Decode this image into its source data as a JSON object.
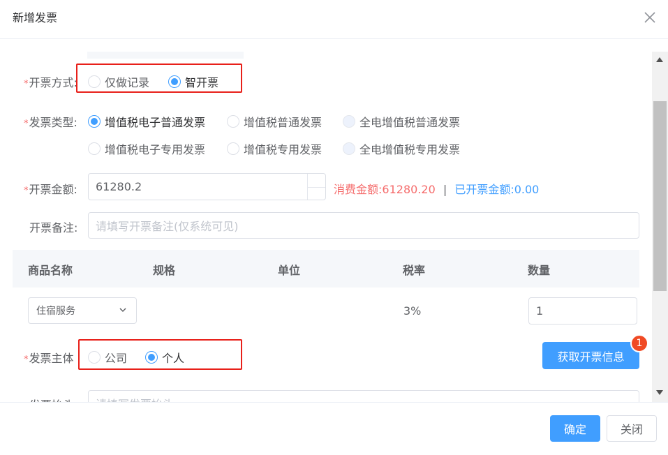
{
  "dialog": {
    "title": "新增发票"
  },
  "form": {
    "issue_method": {
      "label": "开票方式",
      "colon": ":",
      "required_mark": "*",
      "options": [
        {
          "label": "仅做记录",
          "checked": false
        },
        {
          "label": "智开票",
          "checked": true
        }
      ]
    },
    "invoice_type": {
      "label": "发票类型:",
      "required_mark": "*",
      "options": [
        {
          "label": "增值税电子普通发票",
          "checked": true,
          "disabled": false
        },
        {
          "label": "增值税普通发票",
          "checked": false,
          "disabled": false
        },
        {
          "label": "全电增值税普通发票",
          "checked": false,
          "disabled": true
        },
        {
          "label": "增值税电子专用发票",
          "checked": false,
          "disabled": false
        },
        {
          "label": "增值税专用发票",
          "checked": false,
          "disabled": false
        },
        {
          "label": "全电增值税专用发票",
          "checked": false,
          "disabled": true
        }
      ]
    },
    "amount": {
      "label": "开票金额:",
      "required_mark": "*",
      "value": "61280.2",
      "consumption_label": "消费金额:",
      "consumption_value": "61280.20",
      "separator": "|",
      "issued_label": "已开票金额:",
      "issued_value": "0.00"
    },
    "remark": {
      "label": "开票备注:",
      "placeholder": "请填写开票备注(仅系统可见)"
    },
    "goods_table": {
      "headers": [
        "商品名称",
        "规格",
        "单位",
        "税率",
        "数量"
      ],
      "rows": [
        {
          "name": "住宿服务",
          "spec": "",
          "unit": "",
          "tax_rate": "3%",
          "quantity": "1"
        }
      ]
    },
    "invoice_subject": {
      "label": "发票主体",
      "required_mark": "*",
      "options": [
        {
          "label": "公司",
          "checked": false
        },
        {
          "label": "个人",
          "checked": true
        }
      ],
      "fetch_button": "获取开票信息",
      "badge_count": "1"
    },
    "invoice_title": {
      "label": "发票抬头",
      "placeholder": "请填写发票抬头"
    }
  },
  "footer": {
    "confirm_label": "确定",
    "close_label": "关闭"
  },
  "colors": {
    "primary": "#409eff",
    "danger": "#f56c6c",
    "highlight_border": "#e8201a",
    "badge": "#f04a24"
  },
  "icons": [
    "close-icon",
    "chevron-down-icon",
    "scroll-up-arrow-icon",
    "scroll-down-arrow-icon"
  ]
}
